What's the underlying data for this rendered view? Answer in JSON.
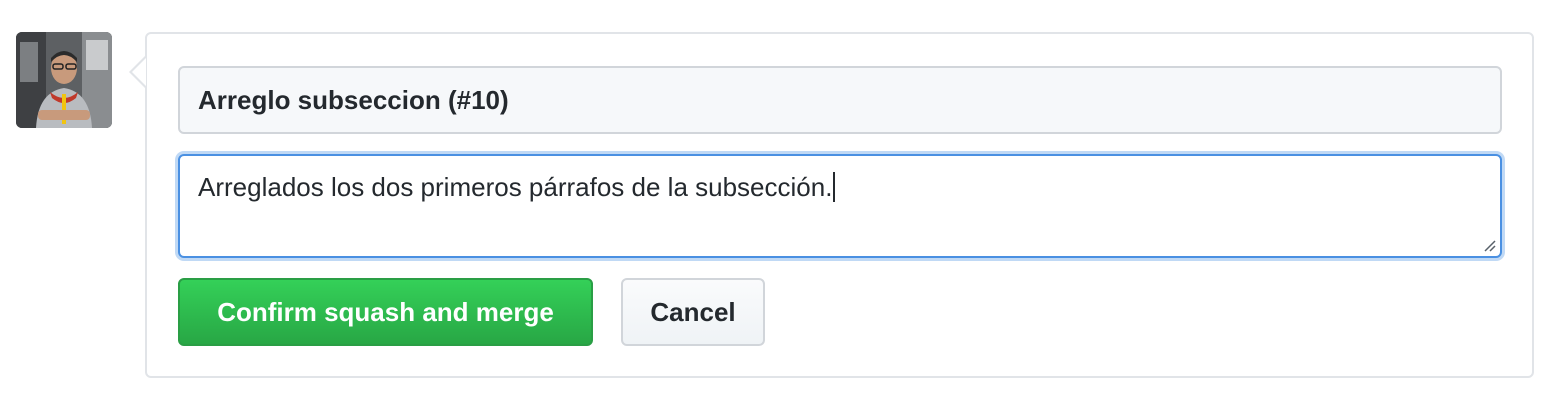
{
  "merge_form": {
    "commit_title": "Arreglo subseccion (#10)",
    "commit_message": "Arreglados los dos primeros párrafos de la subsección.",
    "confirm_label": "Confirm squash and merge",
    "cancel_label": "Cancel"
  },
  "colors": {
    "confirm_button": "#2ea44f",
    "focus_border": "#4a90e2",
    "panel_border": "#e1e4e8"
  }
}
